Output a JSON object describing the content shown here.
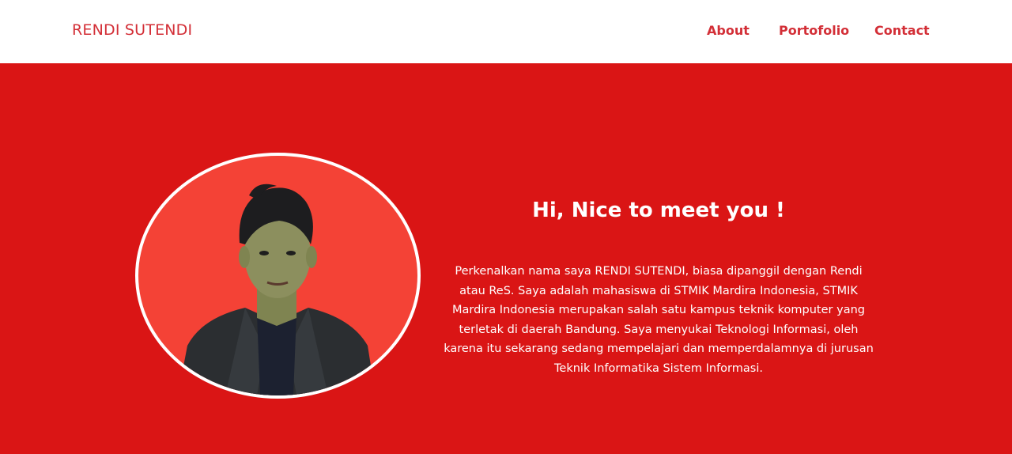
{
  "navbar": {
    "brand": "RENDI SUTENDI",
    "links": [
      "About",
      "Portofolio",
      "Contact"
    ]
  },
  "hero": {
    "photo_alt": "Profile photo",
    "title": "Hi, Nice to meet you !",
    "description": "Perkenalkan nama saya RENDI SUTENDI, biasa dipanggil dengan Rendi atau ReS. Saya adalah mahasiswa di STMIK Mardira Indonesia, STMIK Mardira Indonesia merupakan salah satu kampus teknik komputer yang terletak di daerah Bandung. Saya menyukai Teknologi Informasi, oleh karena itu sekarang sedang mempelajari dan memperdalamnya di jurusan Teknik Informatika Sistem Informasi."
  },
  "colors": {
    "brand": "#d32f37",
    "hero_background": "#da1515",
    "photo_background": "#f44236",
    "text_light": "#ffffff"
  }
}
